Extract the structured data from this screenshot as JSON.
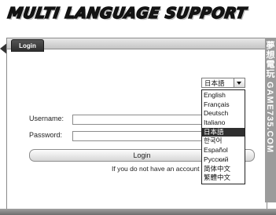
{
  "header": {
    "banner_text": "MULTI LANGUAGE SUPPORT"
  },
  "tabs": [
    {
      "label": "Login"
    }
  ],
  "form": {
    "username_label": "Username:",
    "username_value": "",
    "password_label": "Password:",
    "password_value": "",
    "login_label": "Login",
    "hint_text": "If you do not have an account"
  },
  "language_select": {
    "selected": "日本語",
    "options": [
      "English",
      "Français",
      "Deutsch",
      "Italiano",
      "日本語",
      "한국어",
      "Español",
      "Русский",
      "简体中文",
      "繁體中文"
    ],
    "selected_index": 4
  },
  "watermark": {
    "text": "夢想電玩 GAME735.COM"
  },
  "colors": {
    "accent": "#2f2f2f",
    "tab": "#3a3a3a",
    "watermark_bg": "#9b9b9b"
  }
}
